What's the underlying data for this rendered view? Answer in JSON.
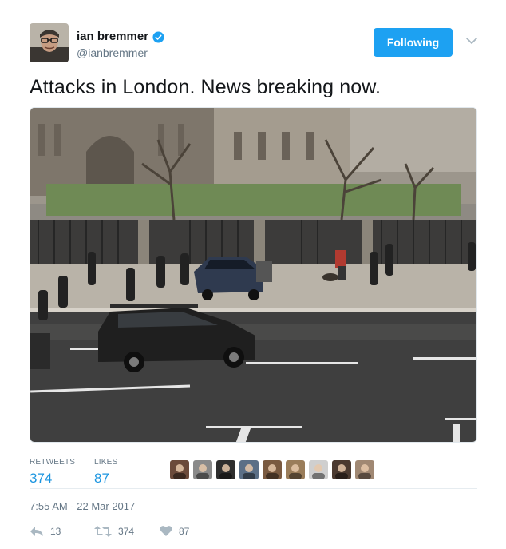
{
  "user": {
    "display_name": "ian bremmer",
    "handle": "@ianbremmer",
    "verified": true
  },
  "follow_button": {
    "label": "Following"
  },
  "tweet": {
    "text": "Attacks in London. News breaking now.",
    "photo": {
      "description_icon": "street-scene"
    }
  },
  "stats": {
    "retweets_label": "RETWEETS",
    "retweets_count": "374",
    "likes_label": "LIKES",
    "likes_count": "87"
  },
  "likers": [
    {
      "tone": "#6b4a3a"
    },
    {
      "tone": "#8a8a8a"
    },
    {
      "tone": "#2e2e2e"
    },
    {
      "tone": "#5b6f86"
    },
    {
      "tone": "#7a5a40"
    },
    {
      "tone": "#9a7d5a"
    },
    {
      "tone": "#cfcfcf"
    },
    {
      "tone": "#4b3a30"
    },
    {
      "tone": "#a08873"
    }
  ],
  "timestamp": "7:55 AM - 22 Mar 2017",
  "actions": {
    "reply_count": "13",
    "retweet_count": "374",
    "like_count": "87"
  },
  "colors": {
    "accent": "#1da1f2",
    "link": "#1b95e0",
    "secondary_text": "#657786",
    "divider": "#e6ecf0"
  }
}
